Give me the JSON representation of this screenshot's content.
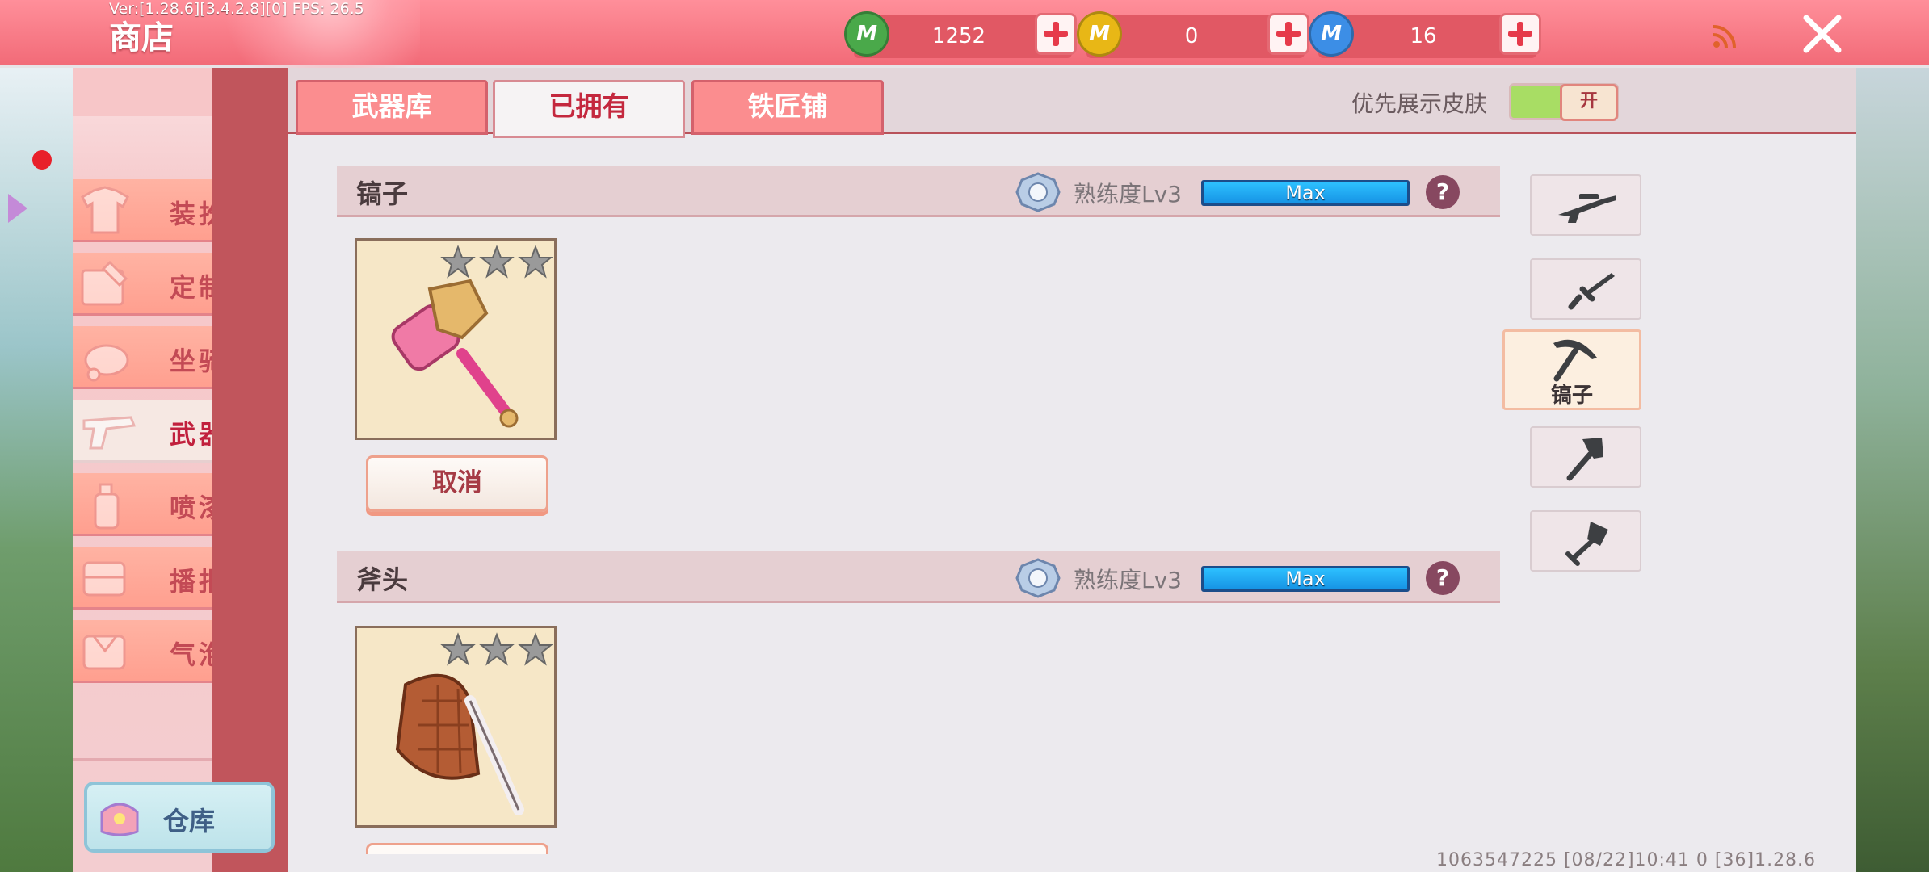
{
  "header": {
    "version": "Ver:[1.28.6][3.4.2.8][0] FPS: 26.5",
    "title": "商店",
    "currencies": [
      {
        "icon": "green-m-coin-icon",
        "amount": "1252",
        "color": "#4aa94a"
      },
      {
        "icon": "gold-m-coin-icon",
        "amount": "0",
        "color": "#e8b716"
      },
      {
        "icon": "blue-m-coin-icon",
        "amount": "16",
        "color": "#3c8ee6"
      }
    ]
  },
  "sidebar": {
    "items": [
      {
        "label": "装扮",
        "icon": "tshirt-icon"
      },
      {
        "label": "定制",
        "icon": "paint-brush-icon"
      },
      {
        "label": "坐骑",
        "icon": "mount-icon"
      },
      {
        "label": "武器",
        "icon": "gun-icon",
        "active": true
      },
      {
        "label": "喷漆",
        "icon": "spray-can-icon"
      },
      {
        "label": "播报",
        "icon": "broadcast-box-icon"
      },
      {
        "label": "气泡",
        "icon": "bubble-box-icon"
      }
    ],
    "warehouse_label": "仓库"
  },
  "tabs": [
    {
      "label": "武器库"
    },
    {
      "label": "已拥有",
      "active": true
    },
    {
      "label": "铁匠铺"
    }
  ],
  "skin_toggle": {
    "label": "优先展示皮肤",
    "state": "开",
    "on": true
  },
  "weapons": [
    {
      "name": "镐子",
      "proficiency": "熟练度Lv3",
      "bar_label": "Max",
      "stars": 3,
      "button": "取消"
    },
    {
      "name": "斧头",
      "proficiency": "熟练度Lv3",
      "bar_label": "Max",
      "stars": 3
    }
  ],
  "categories": [
    {
      "icon": "sniper-rifle-icon"
    },
    {
      "icon": "dagger-icon"
    },
    {
      "icon": "pickaxe-icon",
      "label": "镐子",
      "active": true
    },
    {
      "icon": "axe-icon"
    },
    {
      "icon": "shovel-icon"
    }
  ],
  "footer": {
    "info": "1063547225  [08/22]10:41 0  [36]1.28.6"
  }
}
